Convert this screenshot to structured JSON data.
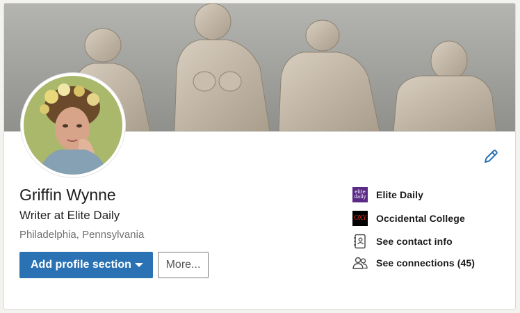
{
  "profile": {
    "name": "Griffin Wynne",
    "headline": "Writer at Elite Daily",
    "location": "Philadelphia, Pennsylvania"
  },
  "actions": {
    "add_section_label": "Add profile section",
    "more_label": "More..."
  },
  "sidebar": {
    "items": [
      {
        "label": "Elite Daily",
        "icon": "elite-daily-logo"
      },
      {
        "label": "Occidental College",
        "icon": "oxy-logo"
      },
      {
        "label": "See contact info",
        "icon": "contact-card-icon"
      },
      {
        "label": "See connections (45)",
        "icon": "connections-icon"
      }
    ],
    "logo_texts": {
      "elite_daily": [
        "elite",
        "daily"
      ],
      "oxy": "OXY"
    }
  },
  "colors": {
    "primary_button": "#2a72b3",
    "edit_icon": "#2a72b3",
    "elite_daily_brand": "#5b2a86",
    "oxy_brand": "#d52d1f"
  }
}
